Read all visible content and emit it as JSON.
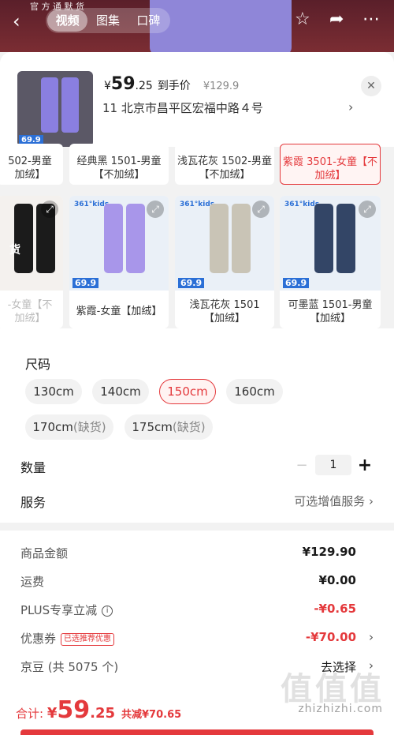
{
  "top": {
    "tabs": [
      "视频",
      "图集",
      "口碑"
    ],
    "active_tab": 0,
    "strip_text": "官 方 通 默 货",
    "icons": [
      "back-icon",
      "favorite-star-icon",
      "share-icon",
      "more-icon"
    ]
  },
  "product": {
    "currency": "¥",
    "price_int": "59",
    "price_dec": ".25",
    "price_tag": "到手价",
    "original_price": "¥129.9",
    "address": "11 北京市昌平区宏福中路４号",
    "badge": "69.9"
  },
  "variants_row1": [
    "502-男童\n加绒】",
    "经典黑 1501-男童\n【不加绒】",
    "浅瓦花灰 1502-男童\n【不加绒】",
    "紫霞 3501-女童【不\n加绒】"
  ],
  "variants_row2": [
    {
      "label": "-女童【不\n加绒】",
      "badge": "",
      "corner_text": "货",
      "color": "#1b1b1b"
    },
    {
      "label": "紫霞-女童【加绒】",
      "badge": "69.9",
      "color": "#a896ea"
    },
    {
      "label": "浅瓦花灰 1501\n【加绒】",
      "badge": "69.9",
      "color": "#c9c4b6"
    },
    {
      "label": "可墨蓝 1501-男童\n【加绒】",
      "badge": "69.9",
      "color": "#334566"
    }
  ],
  "variant_badge_text": "361°kids",
  "size": {
    "label": "尺码",
    "options": [
      "130cm",
      "140cm",
      "150cm",
      "160cm",
      "170cm",
      "175cm"
    ],
    "out_of_stock_suffix": "(缺货)",
    "selected": "150cm"
  },
  "quantity": {
    "label": "数量",
    "value": "1",
    "minus": "−",
    "plus": "+"
  },
  "service": {
    "label": "服务",
    "value": "可选增值服务"
  },
  "summary": {
    "goods_label": "商品金额",
    "goods_value": "¥129.90",
    "shipping_label": "运费",
    "shipping_value": "¥0.00",
    "plus_label": "PLUS专享立减",
    "plus_value": "-¥0.65",
    "coupon_label": "优惠券",
    "coupon_pill": "已选推荐优惠",
    "coupon_value": "-¥70.00",
    "jingdou_label": "京豆 (共 5075 个)",
    "jingdou_value": "去选择"
  },
  "footer": {
    "total_label": "合计:",
    "currency": "¥",
    "total_int": "59",
    "total_dec": ".25",
    "save_text": "共减¥70.65",
    "watermark": "zhizhizhi.com",
    "watermark_logo": "值值值"
  },
  "colors": {
    "accent": "#e4393c",
    "thumb_purple": "#8a7fe0",
    "badge_blue": "#2b6fd6"
  }
}
